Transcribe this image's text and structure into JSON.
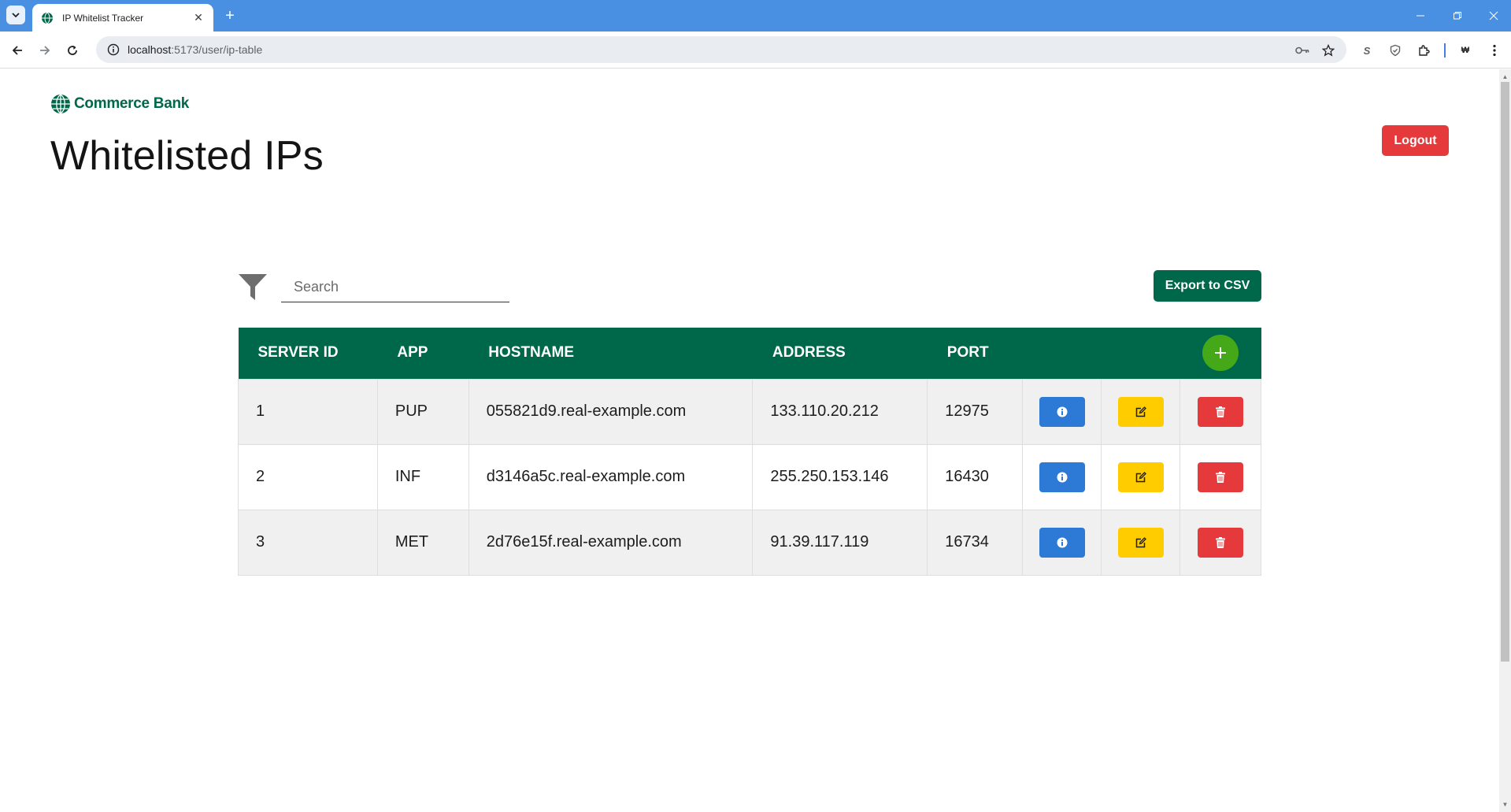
{
  "browser": {
    "tab_title": "IP Whitelist Tracker",
    "url_host": "localhost",
    "url_rest": ":5173/user/ip-table"
  },
  "header": {
    "logo_text": "Commerce Bank",
    "title": "Whitelisted IPs",
    "logout_label": "Logout"
  },
  "toolbar": {
    "search_placeholder": "Search",
    "export_label": "Export to CSV"
  },
  "table": {
    "columns": [
      "SERVER ID",
      "APP",
      "HOSTNAME",
      "ADDRESS",
      "PORT"
    ],
    "rows": [
      {
        "server_id": "1",
        "app": "PUP",
        "hostname": "055821d9.real-example.com",
        "address": "133.110.20.212",
        "port": "12975"
      },
      {
        "server_id": "2",
        "app": "INF",
        "hostname": "d3146a5c.real-example.com",
        "address": "255.250.153.146",
        "port": "16430"
      },
      {
        "server_id": "3",
        "app": "MET",
        "hostname": "2d76e15f.real-example.com",
        "address": "91.39.117.119",
        "port": "16734"
      }
    ]
  },
  "colors": {
    "brand_green": "#00684a",
    "add_green": "#45a818",
    "info_blue": "#2c7ad6",
    "edit_yellow": "#ffcc00",
    "danger_red": "#e5393b",
    "chrome_blue": "#4a90e2"
  },
  "icons": {
    "row_actions": [
      "info-icon",
      "edit-icon",
      "trash-icon"
    ],
    "header_action": "plus-icon",
    "filter": "filter-icon"
  }
}
